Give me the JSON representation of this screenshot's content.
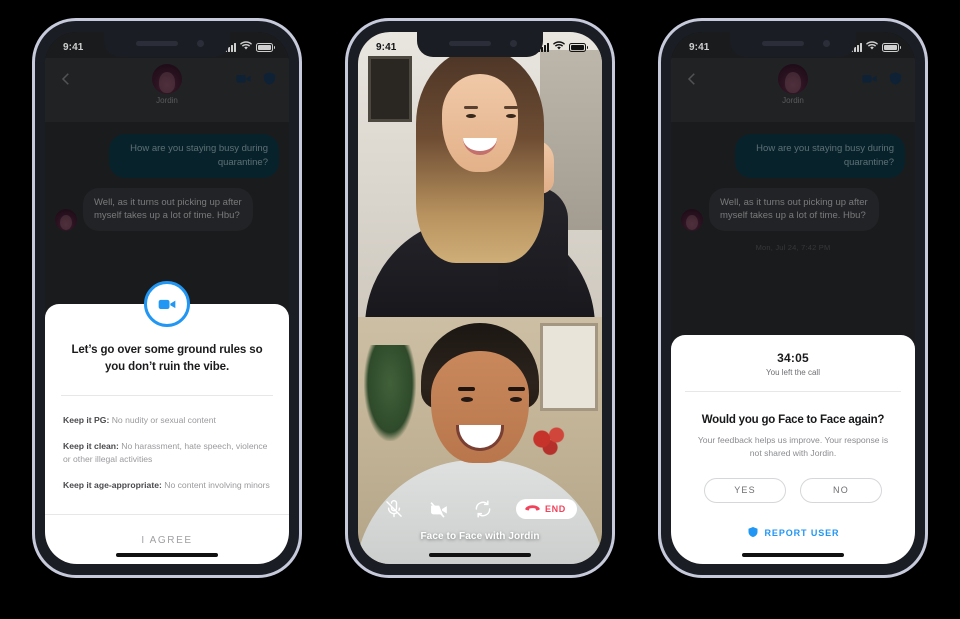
{
  "colors": {
    "accent_blue": "#2196f3",
    "shield_navy": "#1a3a5c",
    "end_red": "#f0435c",
    "bubble_out": "#0e3c4c",
    "bubble_in": "#3c3d42",
    "chat_bg": "#2e2f33",
    "phone_rim": "#c6cadb",
    "phone_bezel": "#1b1d24"
  },
  "status_bar": {
    "time": "9:41",
    "signal_icon": "cellular-bars-icon",
    "wifi_icon": "wifi-icon",
    "battery_icon": "battery-icon"
  },
  "phone1": {
    "header": {
      "back_icon": "chevron-left-icon",
      "contact_name": "Jordin",
      "avatar_icon": "avatar",
      "video_icon": "video-camera-icon",
      "shield_icon": "shield-icon"
    },
    "messages": [
      {
        "direction": "out",
        "text": "How are you staying busy during quarantine?"
      },
      {
        "direction": "in",
        "text": "Well, as it turns out picking up after myself takes up a lot of time. Hbu?"
      }
    ],
    "sheet": {
      "badge_icon": "video-camera-icon",
      "title": "Let’s go over some ground rules so you don’t ruin the vibe.",
      "rules": [
        {
          "label": "Keep it PG:",
          "text": " No nudity or sexual content"
        },
        {
          "label": "Keep it clean:",
          "text": " No harassment, hate speech, violence or other illegal activities"
        },
        {
          "label": "Keep it age-appropriate:",
          "text": " No content involving minors"
        }
      ],
      "agree_label": "I AGREE"
    }
  },
  "phone2": {
    "remote_video_label": "remote-video-feed",
    "local_video_label": "local-video-feed",
    "controls": [
      {
        "name": "mic-off-icon",
        "label": ""
      },
      {
        "name": "video-off-icon",
        "label": ""
      },
      {
        "name": "camera-flip-icon",
        "label": ""
      }
    ],
    "end_button": {
      "icon": "phone-hangup-icon",
      "label": "END"
    },
    "caption": "Face to Face with Jordin"
  },
  "phone3": {
    "header": {
      "back_icon": "chevron-left-icon",
      "contact_name": "Jordin",
      "avatar_icon": "avatar",
      "video_icon": "video-camera-icon",
      "shield_icon": "shield-icon"
    },
    "messages": [
      {
        "direction": "out",
        "text": "How are you staying busy during quarantine?"
      },
      {
        "direction": "in",
        "text": "Well, as it turns out picking up after myself takes up a lot of time. Hbu?"
      }
    ],
    "timestamp": "Mon, Jul 24, 7:42 PM",
    "sheet": {
      "call_duration": "34:05",
      "call_status": "You left the call",
      "question": "Would you go Face to Face again?",
      "description": "Your feedback helps us improve. Your response is not shared with Jordin.",
      "yes_label": "YES",
      "no_label": "NO",
      "report_icon": "shield-icon",
      "report_label": "REPORT USER"
    }
  }
}
